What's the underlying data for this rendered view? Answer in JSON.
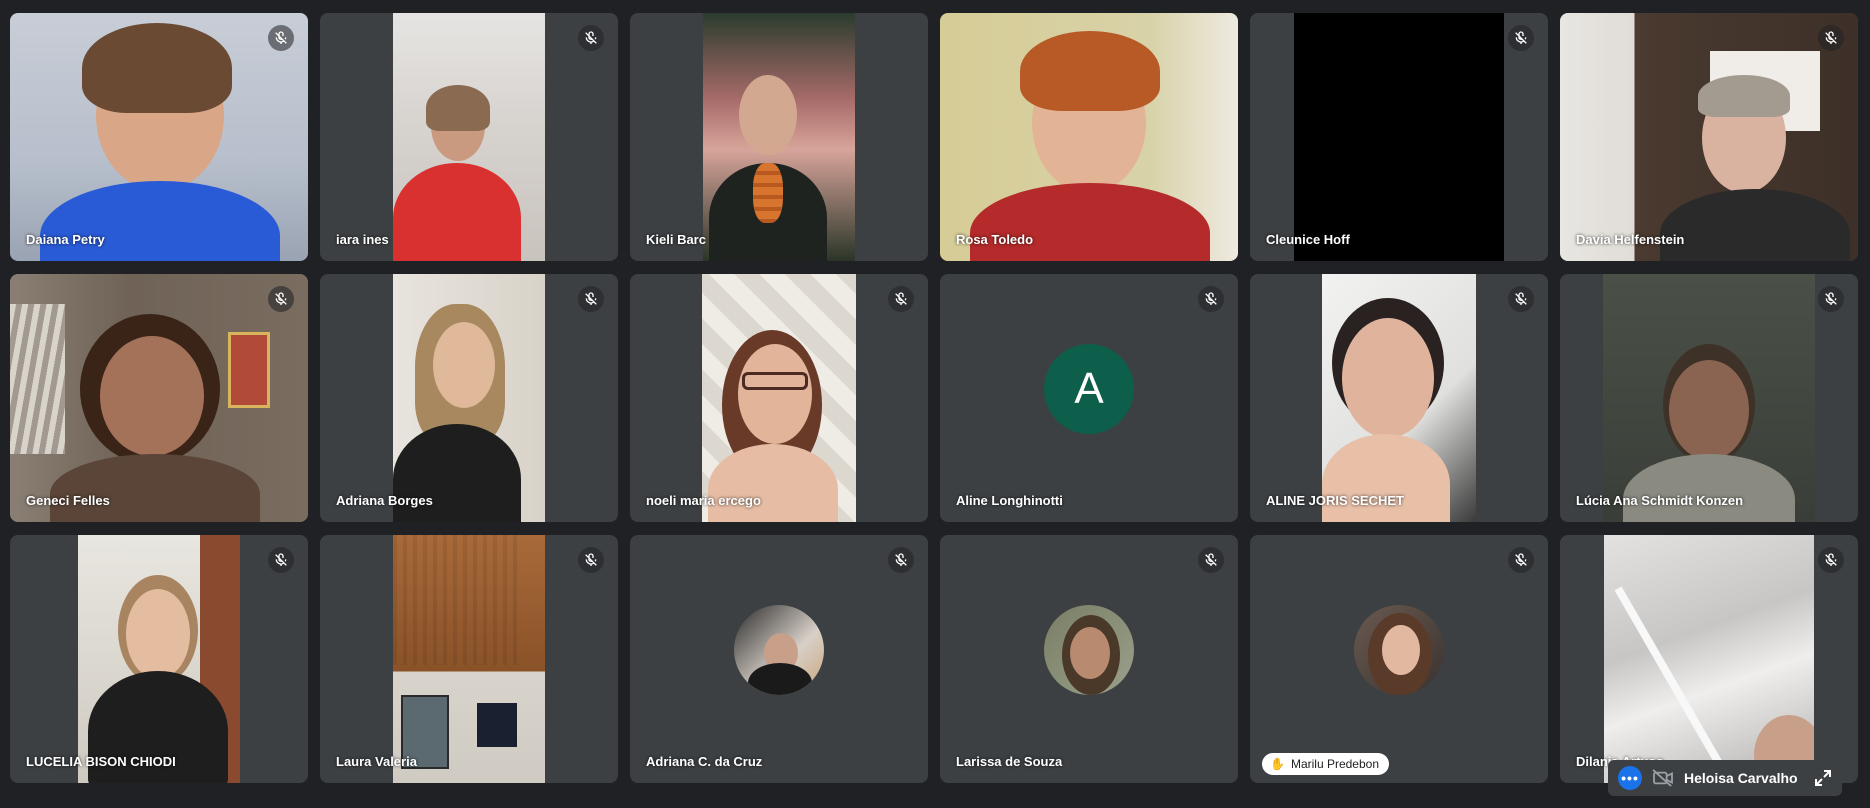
{
  "participants": [
    {
      "name": "Daiana Petry",
      "muted": true,
      "view": "video"
    },
    {
      "name": "iara ines",
      "muted": true,
      "view": "video"
    },
    {
      "name": "Kieli Barc",
      "muted": false,
      "view": "video"
    },
    {
      "name": "Rosa Toledo",
      "muted": false,
      "view": "video"
    },
    {
      "name": "Cleunice Hoff",
      "muted": true,
      "view": "video"
    },
    {
      "name": "Davia Helfenstein",
      "muted": true,
      "view": "video"
    },
    {
      "name": "Geneci Felles",
      "muted": true,
      "view": "video"
    },
    {
      "name": "Adriana Borges",
      "muted": true,
      "view": "video"
    },
    {
      "name": "noeli maria ercego",
      "muted": true,
      "view": "video"
    },
    {
      "name": "Aline Longhinotti",
      "muted": true,
      "view": "avatar",
      "avatar_letter": "A"
    },
    {
      "name": "ALINE JORIS SECHET",
      "muted": true,
      "view": "video"
    },
    {
      "name": "Lúcia Ana Schmidt Konzen",
      "muted": true,
      "view": "video"
    },
    {
      "name": "LUCELIA BISON CHIODI",
      "muted": true,
      "view": "video"
    },
    {
      "name": "Laura Valeria",
      "muted": true,
      "view": "video"
    },
    {
      "name": "Adriana C. da Cruz",
      "muted": true,
      "view": "avatar"
    },
    {
      "name": "Larissa de Souza",
      "muted": true,
      "view": "avatar"
    },
    {
      "name": "Marilu Predebon",
      "muted": true,
      "view": "avatar",
      "hand_raised": true
    },
    {
      "name": "Dilania Artuso",
      "muted": true,
      "view": "video"
    }
  ],
  "self_view": {
    "name": "Heloisa Carvalho",
    "more_label": "•••"
  },
  "colors": {
    "background": "#202124",
    "tile": "#3c4043",
    "accent": "#1a73e8",
    "avatar_green": "#0d5e4a"
  },
  "icons": {
    "mute": "mic-off-icon",
    "hand": "raised-hand-icon",
    "camera_off": "camera-off-icon",
    "expand": "expand-icon"
  }
}
